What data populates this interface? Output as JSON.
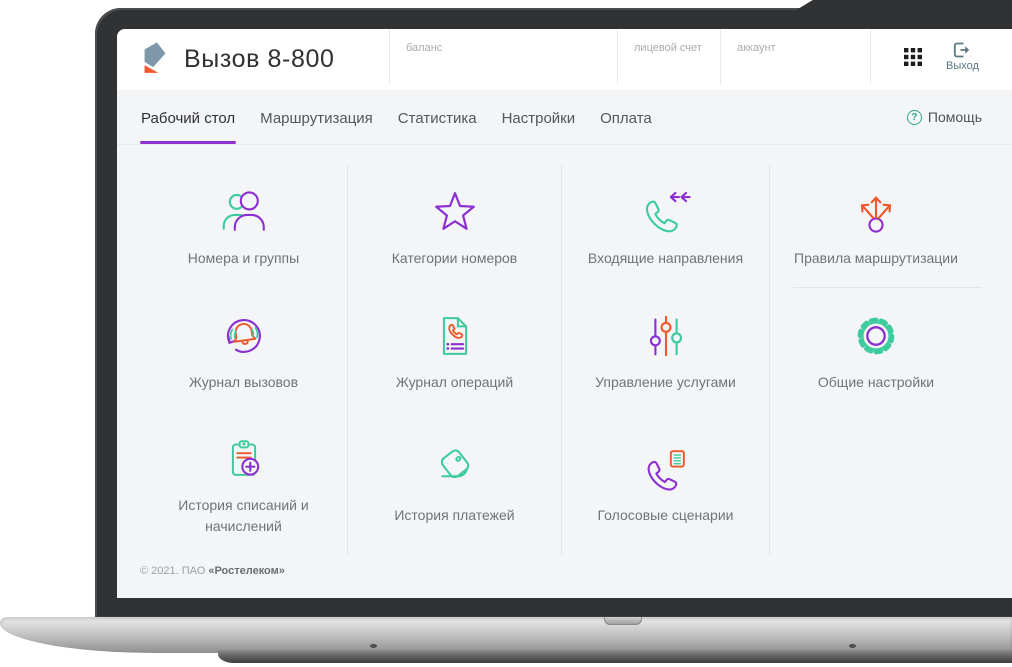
{
  "header": {
    "title": "Вызов 8-800",
    "balance_label": "баланс",
    "personal_account_label": "лицевой счет",
    "account_label": "аккаунт",
    "logout_label": "Выход",
    "icons": [
      "rostelecom-logo",
      "apps-grid-icon",
      "logout-icon"
    ]
  },
  "nav": {
    "tabs": [
      {
        "label": "Рабочий стол",
        "active": true
      },
      {
        "label": "Маршрутизация",
        "active": false
      },
      {
        "label": "Статистика",
        "active": false
      },
      {
        "label": "Настройки",
        "active": false
      },
      {
        "label": "Оплата",
        "active": false
      }
    ],
    "help_label": "Помощь",
    "help_icon_glyph": "?"
  },
  "tiles": [
    {
      "label": "Номера и группы",
      "icon": "users-icon"
    },
    {
      "label": "Категории номеров",
      "icon": "star-icon"
    },
    {
      "label": "Входящие направления",
      "icon": "incoming-call-icon"
    },
    {
      "label": "Правила маршрутизации",
      "icon": "routing-arrows-icon"
    },
    {
      "label": "Журнал вызовов",
      "icon": "call-log-bell-icon"
    },
    {
      "label": "Журнал операций",
      "icon": "operations-document-icon"
    },
    {
      "label": "Управление услугами",
      "icon": "service-sliders-icon"
    },
    {
      "label": "Общие настройки",
      "icon": "gear-icon"
    },
    {
      "label": "История списаний и начислений",
      "icon": "charges-clipboard-icon"
    },
    {
      "label": "История платежей",
      "icon": "wallet-icon"
    },
    {
      "label": "Голосовые сценарии",
      "icon": "voice-script-phone-icon"
    }
  ],
  "footer": {
    "copyright_prefix": "© 2021. ПАО ",
    "company": "«Ростелеком»"
  },
  "colors": {
    "purple": "#8C30D2",
    "teal": "#3CCB9C",
    "orange": "#F0582C",
    "slate_logout": "#5D7683",
    "help_teal": "#2EA88B",
    "logo_blue": "#7E98A9",
    "logo_orange": "#F0582C",
    "tab_underline": "#8C30D2"
  }
}
